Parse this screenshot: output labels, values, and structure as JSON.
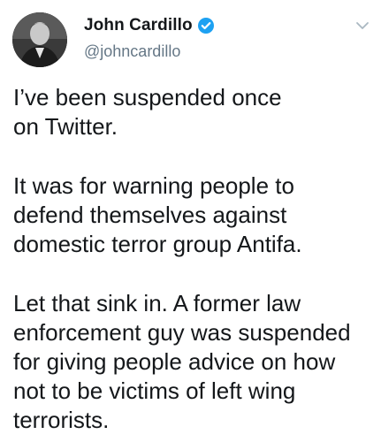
{
  "author": {
    "display_name": "John Cardillo",
    "handle": "@johncardillo",
    "verified": true,
    "verified_color": "#1da1f2"
  },
  "icons": {
    "verified": "verified-badge-icon",
    "menu": "chevron-down-icon"
  },
  "tweet": {
    "paragraphs": [
      {
        "lines": [
          "I’ve been suspended once",
          "on Twitter."
        ]
      },
      {
        "lines": [
          "It was for warning people to",
          "defend themselves against",
          "domestic terror group Antifa."
        ]
      },
      {
        "lines": [
          "Let that sink in. A former law",
          "enforcement guy was suspended",
          "for giving people advice on how",
          "not to be victims of left wing",
          "terrorists."
        ]
      }
    ]
  }
}
